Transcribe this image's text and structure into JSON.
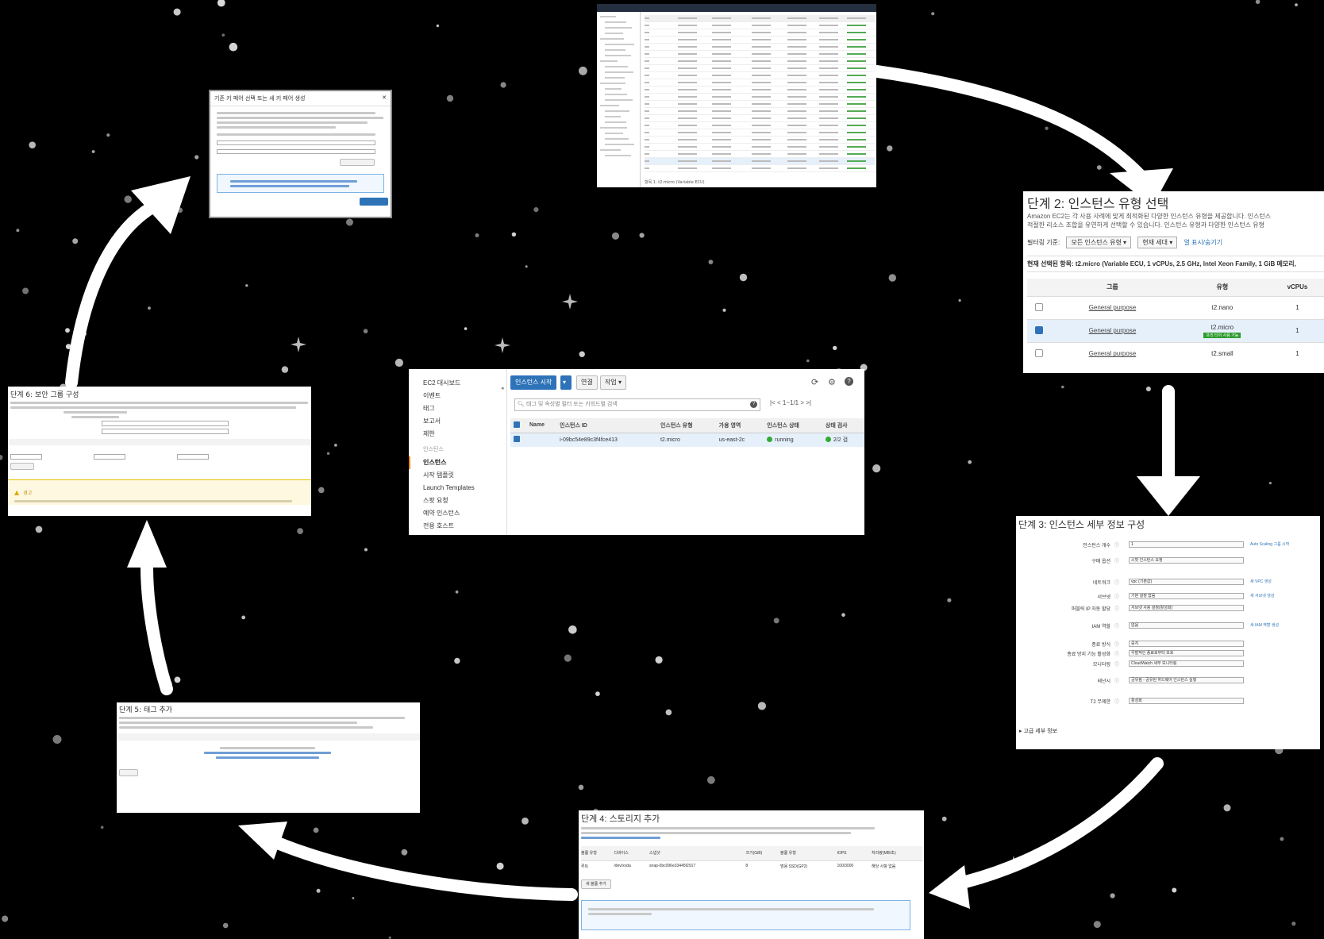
{
  "console": {
    "sidebar": [
      {
        "label": "EC2 대시보드",
        "type": "item"
      },
      {
        "label": "이벤트",
        "type": "item"
      },
      {
        "label": "태그",
        "type": "item"
      },
      {
        "label": "보고서",
        "type": "item"
      },
      {
        "label": "제한",
        "type": "item"
      },
      {
        "label": "인스턴스",
        "type": "section"
      },
      {
        "label": "인스턴스",
        "type": "active"
      },
      {
        "label": "시작 템플릿",
        "type": "item"
      },
      {
        "label": "Launch Templates",
        "type": "item"
      },
      {
        "label": "스팟 요청",
        "type": "item"
      },
      {
        "label": "예약 인스턴스",
        "type": "item"
      },
      {
        "label": "전용 호스트",
        "type": "item"
      }
    ],
    "launch_button": "인스턴스 시작",
    "connect_button": "연결",
    "actions_button": "작업",
    "search_placeholder": "태그 및 속성별 필터 또는 키워드별 검색",
    "pager": "1~1/1",
    "columns": [
      "Name",
      "인스턴스 ID",
      "인스턴스 유형",
      "가용 영역",
      "인스턴스 상태",
      "상태 검사"
    ],
    "rows": [
      {
        "name": "",
        "id": "i-09bc54e89c3f4fce413",
        "type": "t2.micro",
        "az": "us-east-2c",
        "state": "running",
        "check": "2/2 검"
      }
    ]
  },
  "step2": {
    "title": "단계 2: 인스턴스 유형 선택",
    "desc1": "Amazon EC2는 각 사용 사례에 맞게 최적화된 다양한 인스턴스 유형을 제공합니다. 인스턴스",
    "desc2": "적절한 리소스 조합을 유연하게 선택할 수 있습니다. 인스턴스 유형과 다양한 인스턴스 유형",
    "filter_label": "필터링 기준:",
    "filter_all": "모든 인스턴스 유형",
    "filter_gen": "현재 세대",
    "filter_link": "열 표시/숨기기",
    "current": "현재 선택된 항목: t2.micro (Variable ECU, 1 vCPUs, 2.5 GHz, Intel Xeon Family, 1 GiB 메모리,",
    "columns": [
      "그룹",
      "유형",
      "vCPUs"
    ],
    "rows": [
      {
        "group": "General purpose",
        "type": "t2.nano",
        "vcpus": "1",
        "badge": ""
      },
      {
        "group": "General purpose",
        "type": "t2.micro",
        "vcpus": "1",
        "badge": "프리 티어 사용 가능"
      },
      {
        "group": "General purpose",
        "type": "t2.small",
        "vcpus": "1",
        "badge": ""
      }
    ]
  },
  "step3": {
    "title": "단계 3: 인스턴스 세부 정보 구성",
    "fields": [
      {
        "label": "인스턴스 개수",
        "value": "1",
        "link": "Auto Scaling 그룹 시작"
      },
      {
        "label": "구매 옵션",
        "value": "스팟 인스턴스 요청",
        "link": ""
      },
      {
        "label": "네트워크",
        "value": "vpc (기본값)",
        "link": "새 VPC 생성"
      },
      {
        "label": "서브넷",
        "value": "기본 설정 없음",
        "link": "새 서브넷 생성"
      },
      {
        "label": "퍼블릭 IP 자동 할당",
        "value": "서브넷 사용 설정(활성화)",
        "link": ""
      },
      {
        "label": "IAM 역할",
        "value": "없음",
        "link": "새 IAM 역할 생성"
      },
      {
        "label": "종료 방식",
        "value": "중지",
        "link": ""
      },
      {
        "label": "종료 방지 기능 활성화",
        "value": "우발적인 종료로부터 보호",
        "link": ""
      },
      {
        "label": "모니터링",
        "value": "CloudWatch 세부 모니터링",
        "link": ""
      },
      {
        "label": "테넌시",
        "value": "공유됨 - 공유된 하드웨어 인스턴스 실행",
        "link": ""
      },
      {
        "label": "T2 무제한",
        "value": "활성화",
        "link": ""
      }
    ],
    "advanced": "고급 세부 정보"
  },
  "step4": {
    "title": "단계 4: 스토리지 추가",
    "add_button": "새 볼륨 추가",
    "columns": [
      "볼륨 유형",
      "디바이스",
      "스냅샷",
      "크기(GiB)",
      "볼륨 유형",
      "IOPS",
      "처리량(MB/초)"
    ],
    "row": [
      "루트",
      "/dev/xvda",
      "snap-0bc096e33445f2917",
      "8",
      "범용 SSD(GP2)",
      "100/3000",
      "해당 사항 없음"
    ]
  },
  "list": {
    "footer": "항목 1: t2.micro (Variable ECU)"
  },
  "dialog": {
    "title": "기존 키 페어 선택 또는 새 키 페어 생성"
  },
  "sg": {
    "title": "단계 6: 보안 그룹 구성",
    "warning": "경고"
  },
  "tags": {
    "title": "단계 5: 태그 추가"
  }
}
